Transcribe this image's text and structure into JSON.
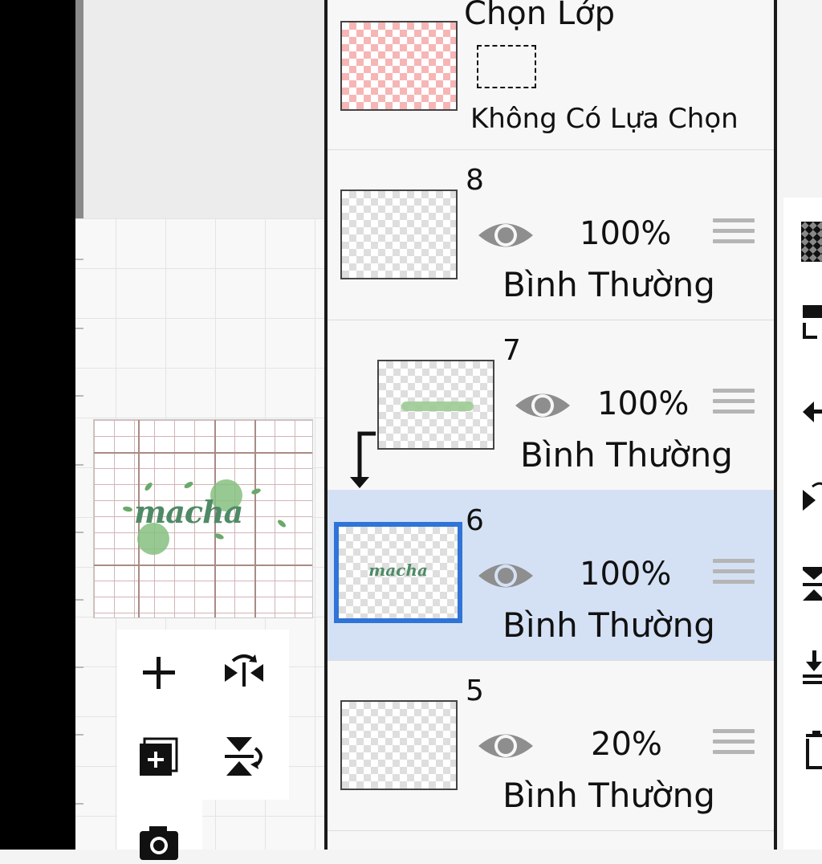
{
  "selection_layer": {
    "title": "Chọn Lớp",
    "status": "Không Có Lựa Chọn"
  },
  "layers": [
    {
      "number": "8",
      "opacity": "100%",
      "blend_mode": "Bình Thường",
      "selected": false
    },
    {
      "number": "7",
      "opacity": "100%",
      "blend_mode": "Bình Thường",
      "selected": false,
      "clipping": true
    },
    {
      "number": "6",
      "opacity": "100%",
      "blend_mode": "Bình Thường",
      "selected": true,
      "thumb_text": "macha"
    },
    {
      "number": "5",
      "opacity": "20%",
      "blend_mode": "Bình Thường",
      "selected": false
    }
  ],
  "preview": {
    "word": "macha"
  },
  "tools": [
    "add-layer",
    "flip-horizontal",
    "add-layer-copy",
    "flip-vertical",
    "camera"
  ],
  "colors": {
    "selected_bg": "#d4e1f5",
    "selected_border": "#2f74d6",
    "eye": "#8e8e8e"
  }
}
